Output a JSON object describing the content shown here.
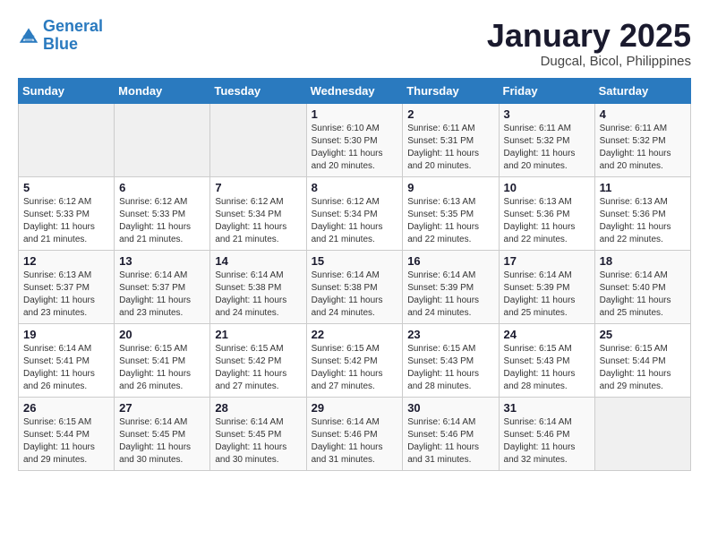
{
  "header": {
    "logo_line1": "General",
    "logo_line2": "Blue",
    "month_title": "January 2025",
    "subtitle": "Dugcal, Bicol, Philippines"
  },
  "weekdays": [
    "Sunday",
    "Monday",
    "Tuesday",
    "Wednesday",
    "Thursday",
    "Friday",
    "Saturday"
  ],
  "weeks": [
    [
      {
        "day": "",
        "sunrise": "",
        "sunset": "",
        "daylight": ""
      },
      {
        "day": "",
        "sunrise": "",
        "sunset": "",
        "daylight": ""
      },
      {
        "day": "",
        "sunrise": "",
        "sunset": "",
        "daylight": ""
      },
      {
        "day": "1",
        "sunrise": "Sunrise: 6:10 AM",
        "sunset": "Sunset: 5:30 PM",
        "daylight": "Daylight: 11 hours and 20 minutes."
      },
      {
        "day": "2",
        "sunrise": "Sunrise: 6:11 AM",
        "sunset": "Sunset: 5:31 PM",
        "daylight": "Daylight: 11 hours and 20 minutes."
      },
      {
        "day": "3",
        "sunrise": "Sunrise: 6:11 AM",
        "sunset": "Sunset: 5:32 PM",
        "daylight": "Daylight: 11 hours and 20 minutes."
      },
      {
        "day": "4",
        "sunrise": "Sunrise: 6:11 AM",
        "sunset": "Sunset: 5:32 PM",
        "daylight": "Daylight: 11 hours and 20 minutes."
      }
    ],
    [
      {
        "day": "5",
        "sunrise": "Sunrise: 6:12 AM",
        "sunset": "Sunset: 5:33 PM",
        "daylight": "Daylight: 11 hours and 21 minutes."
      },
      {
        "day": "6",
        "sunrise": "Sunrise: 6:12 AM",
        "sunset": "Sunset: 5:33 PM",
        "daylight": "Daylight: 11 hours and 21 minutes."
      },
      {
        "day": "7",
        "sunrise": "Sunrise: 6:12 AM",
        "sunset": "Sunset: 5:34 PM",
        "daylight": "Daylight: 11 hours and 21 minutes."
      },
      {
        "day": "8",
        "sunrise": "Sunrise: 6:12 AM",
        "sunset": "Sunset: 5:34 PM",
        "daylight": "Daylight: 11 hours and 21 minutes."
      },
      {
        "day": "9",
        "sunrise": "Sunrise: 6:13 AM",
        "sunset": "Sunset: 5:35 PM",
        "daylight": "Daylight: 11 hours and 22 minutes."
      },
      {
        "day": "10",
        "sunrise": "Sunrise: 6:13 AM",
        "sunset": "Sunset: 5:36 PM",
        "daylight": "Daylight: 11 hours and 22 minutes."
      },
      {
        "day": "11",
        "sunrise": "Sunrise: 6:13 AM",
        "sunset": "Sunset: 5:36 PM",
        "daylight": "Daylight: 11 hours and 22 minutes."
      }
    ],
    [
      {
        "day": "12",
        "sunrise": "Sunrise: 6:13 AM",
        "sunset": "Sunset: 5:37 PM",
        "daylight": "Daylight: 11 hours and 23 minutes."
      },
      {
        "day": "13",
        "sunrise": "Sunrise: 6:14 AM",
        "sunset": "Sunset: 5:37 PM",
        "daylight": "Daylight: 11 hours and 23 minutes."
      },
      {
        "day": "14",
        "sunrise": "Sunrise: 6:14 AM",
        "sunset": "Sunset: 5:38 PM",
        "daylight": "Daylight: 11 hours and 24 minutes."
      },
      {
        "day": "15",
        "sunrise": "Sunrise: 6:14 AM",
        "sunset": "Sunset: 5:38 PM",
        "daylight": "Daylight: 11 hours and 24 minutes."
      },
      {
        "day": "16",
        "sunrise": "Sunrise: 6:14 AM",
        "sunset": "Sunset: 5:39 PM",
        "daylight": "Daylight: 11 hours and 24 minutes."
      },
      {
        "day": "17",
        "sunrise": "Sunrise: 6:14 AM",
        "sunset": "Sunset: 5:39 PM",
        "daylight": "Daylight: 11 hours and 25 minutes."
      },
      {
        "day": "18",
        "sunrise": "Sunrise: 6:14 AM",
        "sunset": "Sunset: 5:40 PM",
        "daylight": "Daylight: 11 hours and 25 minutes."
      }
    ],
    [
      {
        "day": "19",
        "sunrise": "Sunrise: 6:14 AM",
        "sunset": "Sunset: 5:41 PM",
        "daylight": "Daylight: 11 hours and 26 minutes."
      },
      {
        "day": "20",
        "sunrise": "Sunrise: 6:15 AM",
        "sunset": "Sunset: 5:41 PM",
        "daylight": "Daylight: 11 hours and 26 minutes."
      },
      {
        "day": "21",
        "sunrise": "Sunrise: 6:15 AM",
        "sunset": "Sunset: 5:42 PM",
        "daylight": "Daylight: 11 hours and 27 minutes."
      },
      {
        "day": "22",
        "sunrise": "Sunrise: 6:15 AM",
        "sunset": "Sunset: 5:42 PM",
        "daylight": "Daylight: 11 hours and 27 minutes."
      },
      {
        "day": "23",
        "sunrise": "Sunrise: 6:15 AM",
        "sunset": "Sunset: 5:43 PM",
        "daylight": "Daylight: 11 hours and 28 minutes."
      },
      {
        "day": "24",
        "sunrise": "Sunrise: 6:15 AM",
        "sunset": "Sunset: 5:43 PM",
        "daylight": "Daylight: 11 hours and 28 minutes."
      },
      {
        "day": "25",
        "sunrise": "Sunrise: 6:15 AM",
        "sunset": "Sunset: 5:44 PM",
        "daylight": "Daylight: 11 hours and 29 minutes."
      }
    ],
    [
      {
        "day": "26",
        "sunrise": "Sunrise: 6:15 AM",
        "sunset": "Sunset: 5:44 PM",
        "daylight": "Daylight: 11 hours and 29 minutes."
      },
      {
        "day": "27",
        "sunrise": "Sunrise: 6:14 AM",
        "sunset": "Sunset: 5:45 PM",
        "daylight": "Daylight: 11 hours and 30 minutes."
      },
      {
        "day": "28",
        "sunrise": "Sunrise: 6:14 AM",
        "sunset": "Sunset: 5:45 PM",
        "daylight": "Daylight: 11 hours and 30 minutes."
      },
      {
        "day": "29",
        "sunrise": "Sunrise: 6:14 AM",
        "sunset": "Sunset: 5:46 PM",
        "daylight": "Daylight: 11 hours and 31 minutes."
      },
      {
        "day": "30",
        "sunrise": "Sunrise: 6:14 AM",
        "sunset": "Sunset: 5:46 PM",
        "daylight": "Daylight: 11 hours and 31 minutes."
      },
      {
        "day": "31",
        "sunrise": "Sunrise: 6:14 AM",
        "sunset": "Sunset: 5:46 PM",
        "daylight": "Daylight: 11 hours and 32 minutes."
      },
      {
        "day": "",
        "sunrise": "",
        "sunset": "",
        "daylight": ""
      }
    ]
  ]
}
